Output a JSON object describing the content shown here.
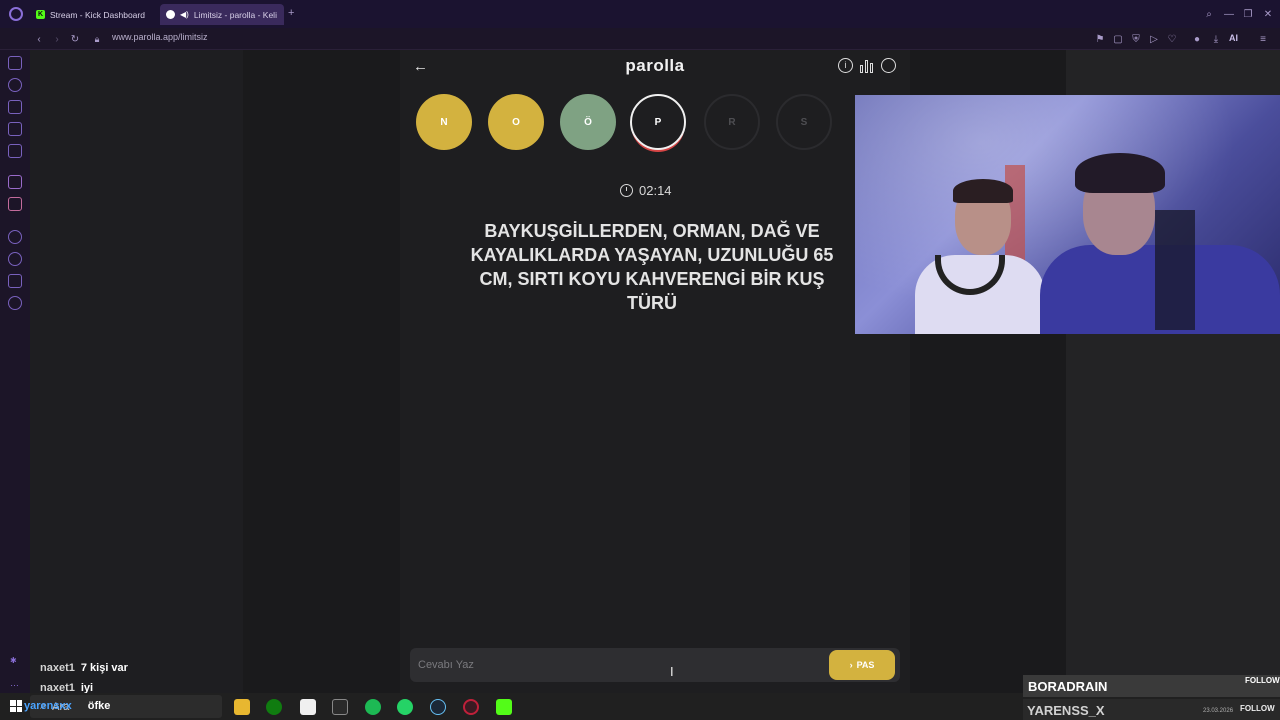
{
  "browser": {
    "tabs": [
      {
        "label": "Stream - Kick Dashboard",
        "favicon": "kick-icon",
        "color": "#53fc18"
      },
      {
        "label": "Limitsiz - parolla - Keli",
        "favicon": "parolla-icon",
        "color": "#ffffff"
      }
    ],
    "new_tab": "+",
    "url": "www.parolla.app/limitsiz",
    "ai_label": "AI"
  },
  "game": {
    "logo": "parolla",
    "letters": [
      {
        "letter": "N",
        "state": "passed",
        "color": "#d3b23f"
      },
      {
        "letter": "O",
        "state": "passed",
        "color": "#d3b23f"
      },
      {
        "letter": "Ö",
        "state": "correct",
        "color": "#7fa283"
      },
      {
        "letter": "P",
        "state": "active",
        "color": "#1e1e20"
      },
      {
        "letter": "R",
        "state": "pending",
        "color": "#1e1e20"
      },
      {
        "letter": "S",
        "state": "pending",
        "color": "#1e1e20"
      }
    ],
    "timer": "02:14",
    "question": "BAYKUŞGİLLERDEN, ORMAN, DAĞ VE KAYALIKLARDA YAŞAYAN, UZUNLUĞU 65 CM, SIRTI KOYU KAHVERENGİ BİR KUŞ TÜRÜ",
    "answer_placeholder": "Cevabı Yaz",
    "pass_label": "PAS",
    "accent": "#d3b23f"
  },
  "chat": [
    {
      "user": "naxet1",
      "message": "7 kişi var"
    },
    {
      "user": "naxet1",
      "message": "iyi"
    },
    {
      "user": "yarensxx",
      "message": "öfke"
    }
  ],
  "taskbar": {
    "search_label": "Ara"
  },
  "stream_overlay": {
    "line1_name": "BORADRAIN",
    "line1_action": "FOLLOW",
    "line2_name": "YARENSS_X",
    "line2_action": "FOLLOW",
    "date": "23.03.2026"
  }
}
